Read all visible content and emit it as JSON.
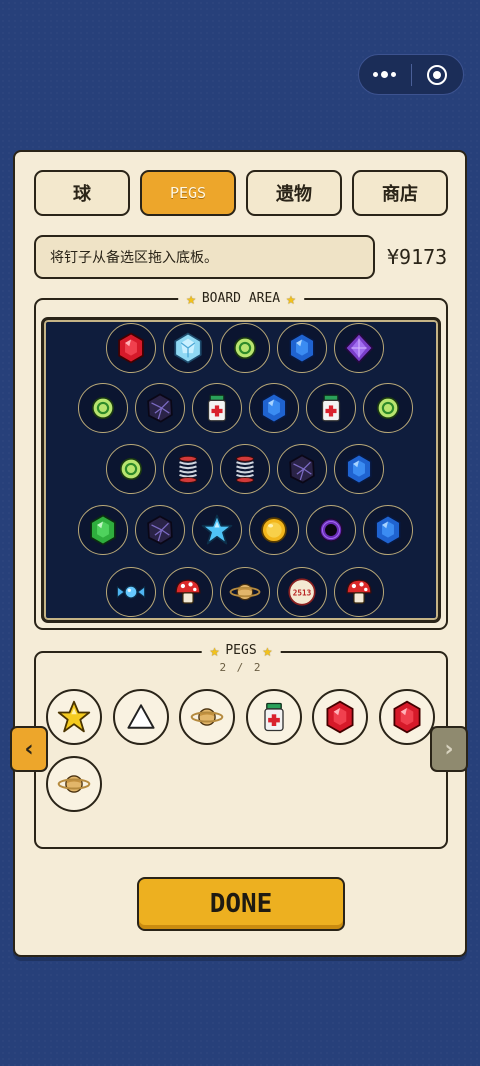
{
  "capsule": {
    "menu_icon": "more-dots-icon",
    "close_icon": "target-close-icon"
  },
  "tabs": [
    {
      "label": "球",
      "active": false
    },
    {
      "label": "PEGS",
      "active": true
    },
    {
      "label": "遗物",
      "active": false
    },
    {
      "label": "商店",
      "active": false
    }
  ],
  "hint": "将钉子从备选区拖入底板。",
  "money": "¥9173",
  "board": {
    "title": "BOARD AREA",
    "rows": [
      [
        "red-gem",
        "ice-crystal",
        "green-swirl",
        "blue-gem",
        "purple-gem"
      ],
      [
        "green-swirl",
        "dark-crystal",
        "medicine-bottle",
        "blue-gem",
        "medicine-bottle",
        "green-swirl"
      ],
      [
        "green-swirl",
        "spring",
        "spring",
        "dark-crystal",
        "blue-gem"
      ],
      [
        "green-gem",
        "dark-crystal",
        "blue-star",
        "gold-coin",
        "black-hole",
        "blue-gem"
      ],
      [
        "candy",
        "mushroom",
        "planet",
        "dice-badge",
        "mushroom"
      ]
    ],
    "dice_text": "2513"
  },
  "pegs": {
    "title": "PEGS",
    "count": "2 / 2",
    "items": [
      "gold-star",
      "white-triangle",
      "planet",
      "medicine-bottle",
      "red-gem",
      "red-gem",
      "planet"
    ]
  },
  "nav": {
    "prev": "‹",
    "next": "›"
  },
  "done_label": "DONE"
}
